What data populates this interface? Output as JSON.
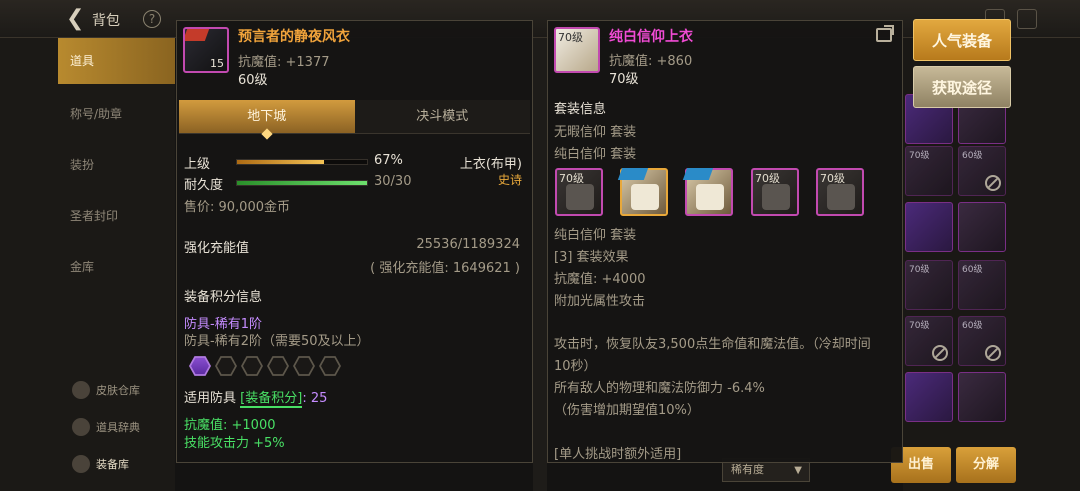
{
  "topbar": {
    "title": "背包",
    "help": "?"
  },
  "sidebar": {
    "tabs": [
      {
        "label": "道具",
        "active": true
      },
      {
        "label": "称号/助章",
        "active": false
      },
      {
        "label": "装扮",
        "active": false
      },
      {
        "label": "圣者封印",
        "active": false
      },
      {
        "label": "金库",
        "active": false
      }
    ],
    "bottom": [
      {
        "label": "皮肤仓库",
        "icon": "wardrobe-icon"
      },
      {
        "label": "道具辞典",
        "icon": "dictionary-icon"
      },
      {
        "label": "装备库",
        "icon": "equipment-library-icon"
      }
    ]
  },
  "left_item": {
    "name": "预言者的静夜风衣",
    "magic_def": "抗魔值: +1377",
    "level": "60级",
    "icon_count": "15",
    "tabs": [
      "地下城",
      "决斗模式"
    ],
    "grade_label": "上级",
    "grade_pct": "67%",
    "grade_fill": 0.67,
    "durability_label": "耐久度",
    "durability_value": "30/30",
    "durability_fill": 1.0,
    "slot_type": "上衣(布甲)",
    "rarity": "史诗",
    "price": "售价: 90,000金币",
    "enhance_title": "强化充能值",
    "enhance_value": "25536/1189324",
    "enhance_sub": "( 强化充能值: 1649621 )",
    "score_title": "装备积分信息",
    "score_current": "防具-稀有1阶",
    "score_next": "防具-稀有2阶（需要50及以上）",
    "hex_total": 6,
    "hex_filled": 1,
    "apply_prefix": "适用防具",
    "apply_tag": "[装备积分]",
    "apply_value": ": 25",
    "bonus1": "抗魔值: +1000",
    "bonus2": "技能攻击力 +5%"
  },
  "right_item": {
    "name": "纯白信仰上衣",
    "magic_def": "抗魔值: +860",
    "level": "70级",
    "icon_level": "70级",
    "set_title": "套装信息",
    "set1": "无暇信仰  套装",
    "set2": "纯白信仰  套装",
    "slot_levels": [
      "70级",
      "",
      "",
      "70级",
      "70级"
    ],
    "set3": "纯白信仰  套装",
    "effect_title": "[3] 套装效果",
    "effect_def": "抗魔值: +4000",
    "effect_light": "附加光属性攻击",
    "desc1": "攻击时，恢复队友3,500点生命值和魔法值。（冷却时间",
    "desc2": "10秒）",
    "desc3": "所有敌人的物理和魔法防御力 -6.4%",
    "desc4": "（伤害增加期望值10%）",
    "note": "[单人挑战时额外适用]"
  },
  "right_panel": {
    "btn_popular": "人气装备",
    "btn_source": "获取途径",
    "btn_sell": "出售",
    "btn_decompose": "分解",
    "sort_label": "稀有度"
  },
  "grid_levels": [
    "",
    "",
    "70级",
    "60级",
    "",
    "",
    "70级",
    "60级",
    "",
    "",
    "70级",
    "60级"
  ],
  "colors": {
    "accent": "#e9a93b",
    "epic": "#f0a33b",
    "set_item": "#f04bd4",
    "green": "#49e065"
  }
}
